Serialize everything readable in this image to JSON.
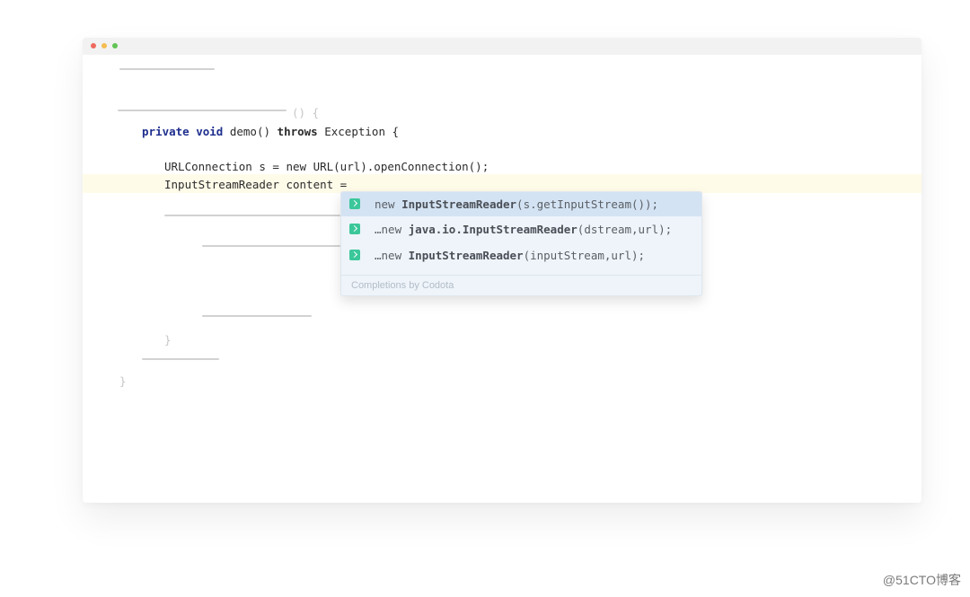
{
  "editor": {
    "line_method_tail": "() {",
    "line_signature": {
      "kw_private": "private",
      "kw_void": "void",
      "name": "demo()",
      "kw_throws": "throws",
      "rest": "Exception {"
    },
    "line_connection": "URLConnection s = new URL(url).openConnection();",
    "line_reader": "InputStreamReader content =",
    "brace_inner": "}",
    "brace_outer": "}"
  },
  "autocomplete": {
    "suggestions": [
      {
        "prefix": "new ",
        "bold": "InputStreamReader",
        "rest": "(s.getInputStream());",
        "selected": true,
        "icon": "codota-icon"
      },
      {
        "prefix": "…new ",
        "bold": "java.io.InputStreamReader",
        "rest": "(dstream,url);",
        "selected": false,
        "icon": "codota-icon"
      },
      {
        "prefix": "…new ",
        "bold": "InputStreamReader",
        "rest": "(inputStream,url);",
        "selected": false,
        "icon": "codota-icon"
      }
    ],
    "footer": "Completions by Codota"
  },
  "watermark": "@51CTO博客",
  "colors": {
    "keyword": "#1f2f8f",
    "highlight_line": "#fffbe9",
    "popup_bg": "#eef4fa",
    "popup_selected": "#d4e3f3",
    "codota_icon": "#3bc79a"
  }
}
